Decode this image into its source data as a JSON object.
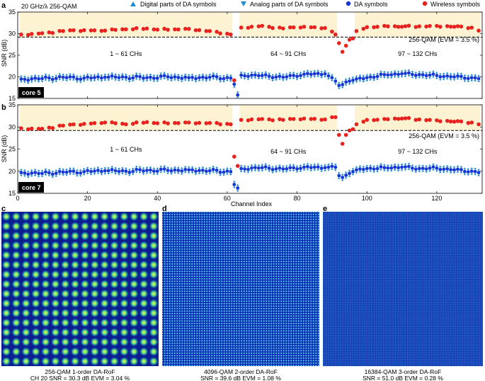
{
  "figure": {
    "panel_letters": [
      "a",
      "b",
      "c",
      "d",
      "e"
    ],
    "header_left": "20 GHz/λ 256-QAM",
    "legend": [
      {
        "label": "Digital parts of DA symbols",
        "marker": "triangle-up",
        "color": "#1f8bd0"
      },
      {
        "label": "Analog parts of DA symbols",
        "marker": "triangle-down",
        "color": "#1f8bd0"
      },
      {
        "label": "DA symbols",
        "marker": "dot",
        "color": "#1537d6"
      },
      {
        "label": "Wireless symbols",
        "marker": "dot",
        "color": "#e8231f"
      }
    ],
    "shared_xlabel": "Channel Index",
    "ylabel": "SNR (dB)",
    "colors": {
      "wireless": "#e8231f",
      "da": "#1537d6",
      "error_bar": "#1f8bd0",
      "band": "#fdf3d2",
      "threshold": "#000000"
    }
  },
  "chart_data": [
    {
      "panel": "a",
      "type": "scatter",
      "core_label": "core 5",
      "xlim": [
        0,
        133
      ],
      "ylim": [
        15,
        35
      ],
      "yticks": [
        15,
        20,
        25,
        30,
        35
      ],
      "xticks": [
        0,
        20,
        40,
        60,
        80,
        100,
        120
      ],
      "threshold": {
        "y": 29.2,
        "label": "256-QAM  (EVM = 3.5 %)"
      },
      "bands": [
        [
          1,
          61
        ],
        [
          64,
          91
        ],
        [
          97,
          132
        ]
      ],
      "band_labels": [
        "1 ~ 61 CHs",
        "64 ~ 91 CHs",
        "97 ~ 132 CHs"
      ],
      "series": [
        {
          "name": "Wireless symbols",
          "x": [
            1,
            7,
            13,
            19,
            25,
            31,
            37,
            43,
            49,
            55,
            61,
            62,
            64,
            70,
            76,
            82,
            88,
            91,
            92,
            93,
            94,
            95,
            96,
            97,
            100,
            105,
            110,
            115,
            120,
            125,
            130,
            132
          ],
          "y": [
            29.8,
            30.1,
            30.6,
            30.8,
            30.7,
            31.0,
            31.2,
            30.9,
            31.1,
            30.6,
            29.8,
            19.2,
            31.4,
            31.8,
            31.2,
            31.6,
            31.3,
            29.8,
            27.8,
            25.8,
            27.2,
            28.6,
            28.9,
            30.6,
            31.5,
            31.8,
            31.6,
            31.7,
            31.8,
            31.6,
            31.4,
            30.7
          ]
        },
        {
          "name": "DA symbols",
          "x": [
            1,
            7,
            13,
            19,
            25,
            31,
            37,
            43,
            49,
            55,
            61,
            62,
            63,
            64,
            70,
            76,
            82,
            88,
            91,
            92,
            93,
            94,
            95,
            96,
            97,
            100,
            105,
            110,
            115,
            120,
            125,
            130,
            132
          ],
          "y": [
            19.5,
            19.6,
            19.9,
            19.7,
            19.9,
            19.9,
            19.8,
            20.0,
            19.8,
            19.9,
            19.7,
            18.3,
            15.8,
            20.4,
            20.3,
            19.9,
            20.6,
            20.7,
            19.0,
            18.0,
            18.2,
            18.8,
            19.0,
            19.2,
            19.5,
            19.8,
            20.5,
            20.7,
            20.5,
            20.3,
            20.0,
            19.8,
            19.6
          ]
        }
      ]
    },
    {
      "panel": "b",
      "type": "scatter",
      "core_label": "core 7",
      "xlabel": "Channel Index",
      "xlim": [
        0,
        133
      ],
      "ylim": [
        15,
        35
      ],
      "yticks": [
        15,
        20,
        25,
        30,
        35
      ],
      "xticks": [
        0,
        20,
        40,
        60,
        80,
        100,
        120
      ],
      "threshold": {
        "y": 29.2,
        "label": "256-QAM  (EVM = 3.5 %)"
      },
      "bands": [
        [
          1,
          61
        ],
        [
          64,
          91
        ],
        [
          97,
          132
        ]
      ],
      "band_labels": [
        "1 ~ 61 CHs",
        "64 ~ 91 CHs",
        "97 ~ 132 CHs"
      ],
      "series": [
        {
          "name": "Wireless symbols",
          "x": [
            1,
            7,
            13,
            19,
            25,
            31,
            37,
            43,
            49,
            55,
            61,
            62,
            63,
            64,
            70,
            76,
            82,
            88,
            91,
            92,
            93,
            94,
            95,
            96,
            97,
            100,
            105,
            110,
            115,
            120,
            125,
            130,
            132
          ],
          "y": [
            29.7,
            29.6,
            30.3,
            30.7,
            31.0,
            30.6,
            31.1,
            30.8,
            31.0,
            30.9,
            30.6,
            23.3,
            21.2,
            31.6,
            31.8,
            31.6,
            31.9,
            31.7,
            32.2,
            28.2,
            26.2,
            28.2,
            29.2,
            29.5,
            30.6,
            31.6,
            31.8,
            31.9,
            31.7,
            31.5,
            31.2,
            31.0,
            30.6
          ]
        },
        {
          "name": "DA symbols",
          "x": [
            1,
            7,
            13,
            19,
            25,
            31,
            37,
            43,
            49,
            55,
            61,
            62,
            63,
            64,
            70,
            76,
            82,
            88,
            91,
            92,
            93,
            94,
            95,
            96,
            97,
            100,
            105,
            110,
            115,
            120,
            125,
            130,
            132
          ],
          "y": [
            19.7,
            19.5,
            19.8,
            19.9,
            20.1,
            20.0,
            20.2,
            20.2,
            20.3,
            20.1,
            19.9,
            17.0,
            16.2,
            20.6,
            20.8,
            20.5,
            20.9,
            20.8,
            20.9,
            19.0,
            18.6,
            19.1,
            19.5,
            19.9,
            20.3,
            20.6,
            20.8,
            20.9,
            20.6,
            20.7,
            20.3,
            20.0,
            19.7
          ]
        }
      ]
    },
    {
      "panel": "c",
      "type": "heatmap",
      "caption_lines": [
        "256-QAM     1-order DA-RoF",
        "CH 20   SNR = 30.3 dB   EVM = 3.04 %"
      ],
      "grid": 16
    },
    {
      "panel": "d",
      "type": "heatmap",
      "caption_lines": [
        "4096-QAM   2-order DA-RoF",
        "SNR = 39.6 dB     EVM = 1.08 %"
      ],
      "grid": 64
    },
    {
      "panel": "e",
      "type": "heatmap",
      "caption_lines": [
        "16384-QAM        3-order DA-RoF",
        "SNR = 51.0 dB     EVM = 0.28 %"
      ],
      "grid": 128
    }
  ]
}
